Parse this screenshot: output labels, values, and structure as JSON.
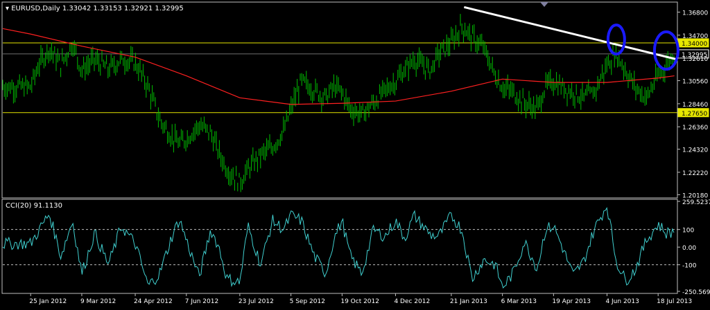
{
  "header": {
    "symbol_label": "EURUSD,Daily",
    "ohlc": "1.33042 1.33153 1.32921 1.32995"
  },
  "indicator": {
    "label": "CCI(20) 91.1130"
  },
  "colors": {
    "background": "#000000",
    "frame": "#c0c0c0",
    "bars": "#00c000",
    "moving_average": "#ff2020",
    "trendline": "#ffffff",
    "horizontal_levels": "#e6e600",
    "circles": "#1a1aff",
    "cci": "#40d0d0",
    "cci_levels": "#c0c0c0",
    "axis_text": "#ffffff",
    "current_price_box": "#ffffff"
  },
  "chart_data": [
    {
      "type": "line",
      "title": "EURUSD,Daily",
      "x_tick_labels": [
        "25 Jan 2012",
        "9 Mar 2012",
        "24 Apr 2012",
        "7 Jun 2012",
        "23 Jul 2012",
        "5 Sep 2012",
        "19 Oct 2012",
        "4 Dec 2012",
        "21 Jan 2013",
        "6 Mar 2013",
        "19 Apr 2013",
        "4 Jun 2013",
        "18 Jul 2013"
      ],
      "y_tick_labels": [
        "1.36800",
        "1.34700",
        "1.32610",
        "1.30560",
        "1.28460",
        "1.26360",
        "1.24320",
        "1.22220",
        "1.20180"
      ],
      "ylim": [
        1.1995,
        1.3765
      ],
      "price_level_labels": [
        "1.34000",
        "1.32995",
        "1.27650"
      ],
      "series": [
        {
          "marks": "daily_bars",
          "x": [
            "2012-01-25",
            "2012-02-01",
            "2012-02-10",
            "2012-02-20",
            "2012-03-01",
            "2012-03-09",
            "2012-03-20",
            "2012-04-01",
            "2012-04-12",
            "2012-04-24",
            "2012-05-05",
            "2012-05-15",
            "2012-05-25",
            "2012-06-01",
            "2012-06-07",
            "2012-06-18",
            "2012-06-28",
            "2012-07-05",
            "2012-07-12",
            "2012-07-23",
            "2012-07-30",
            "2012-08-10",
            "2012-08-20",
            "2012-08-30",
            "2012-09-05",
            "2012-09-14",
            "2012-09-25",
            "2012-10-05",
            "2012-10-12",
            "2012-10-19",
            "2012-10-26",
            "2012-11-05",
            "2012-11-15",
            "2012-11-25",
            "2012-12-04",
            "2012-12-12",
            "2012-12-20",
            "2013-01-03",
            "2013-01-10",
            "2013-01-21",
            "2013-01-30",
            "2013-02-08",
            "2013-02-18",
            "2013-02-28",
            "2013-03-06",
            "2013-03-15",
            "2013-03-25",
            "2013-04-05",
            "2013-04-12",
            "2013-04-19",
            "2013-04-26",
            "2013-05-06",
            "2013-05-15",
            "2013-05-24",
            "2013-06-04",
            "2013-06-12",
            "2013-06-20",
            "2013-06-28",
            "2013-07-08",
            "2013-07-18",
            "2013-07-25",
            "2013-08-01"
          ],
          "values": [
            1.3,
            1.32,
            1.335,
            1.32,
            1.34,
            1.315,
            1.325,
            1.316,
            1.325,
            1.322,
            1.3,
            1.27,
            1.255,
            1.248,
            1.253,
            1.265,
            1.258,
            1.24,
            1.225,
            1.213,
            1.225,
            1.238,
            1.245,
            1.26,
            1.28,
            1.305,
            1.297,
            1.29,
            1.3,
            1.295,
            1.28,
            1.275,
            1.285,
            1.297,
            1.305,
            1.315,
            1.325,
            1.315,
            1.33,
            1.34,
            1.355,
            1.345,
            1.335,
            1.31,
            1.3,
            1.295,
            1.285,
            1.28,
            1.3,
            1.305,
            1.3,
            1.295,
            1.29,
            1.295,
            1.32,
            1.33,
            1.315,
            1.3,
            1.29,
            1.31,
            1.32,
            1.33
          ]
        },
        {
          "marks": "moving_average",
          "x": [
            "2012-01-01",
            "2012-01-25",
            "2012-03-09",
            "2012-04-24",
            "2012-06-07",
            "2012-07-23",
            "2012-09-05",
            "2012-10-19",
            "2012-12-04",
            "2013-01-21",
            "2013-03-06",
            "2013-04-19",
            "2013-06-04",
            "2013-07-18",
            "2013-08-01"
          ],
          "values": [
            1.353,
            1.348,
            1.337,
            1.327,
            1.31,
            1.29,
            1.284,
            1.285,
            1.287,
            1.296,
            1.307,
            1.304,
            1.304,
            1.308,
            1.31
          ]
        },
        {
          "marks": "trendline",
          "x": [
            "2013-02-01",
            "2013-08-03"
          ],
          "values": [
            1.3725,
            1.325
          ]
        }
      ]
    },
    {
      "type": "line",
      "title": "CCI(20) 91.1130",
      "x_tick_labels": [
        "25 Jan 2012",
        "9 Mar 2012",
        "24 Apr 2012",
        "7 Jun 2012",
        "23 Jul 2012",
        "5 Sep 2012",
        "19 Oct 2012",
        "4 Dec 2012",
        "21 Jan 2013",
        "6 Mar 2013",
        "19 Apr 2013",
        "4 Jun 2013",
        "18 Jul 2013"
      ],
      "y_tick_labels": [
        "259.5237",
        "100",
        "0.00",
        "-100",
        "-250.569"
      ],
      "ylim": [
        -250.569,
        259.5237
      ],
      "levels": [
        100,
        -100
      ],
      "series": [
        {
          "name": "CCI(20)",
          "x": [
            "2012-01-25",
            "2012-02-10",
            "2012-02-20",
            "2012-03-01",
            "2012-03-09",
            "2012-03-20",
            "2012-04-01",
            "2012-04-12",
            "2012-04-24",
            "2012-05-05",
            "2012-05-15",
            "2012-05-25",
            "2012-06-01",
            "2012-06-07",
            "2012-06-18",
            "2012-06-28",
            "2012-07-05",
            "2012-07-12",
            "2012-07-23",
            "2012-07-30",
            "2012-08-10",
            "2012-08-20",
            "2012-08-30",
            "2012-09-05",
            "2012-09-14",
            "2012-09-25",
            "2012-10-05",
            "2012-10-12",
            "2012-10-19",
            "2012-10-26",
            "2012-11-05",
            "2012-11-15",
            "2012-11-25",
            "2012-12-04",
            "2012-12-12",
            "2012-12-20",
            "2013-01-03",
            "2013-01-10",
            "2013-01-21",
            "2013-01-30",
            "2013-02-08",
            "2013-02-18",
            "2013-02-28",
            "2013-03-06",
            "2013-03-15",
            "2013-03-25",
            "2013-04-05",
            "2013-04-12",
            "2013-04-19",
            "2013-04-26",
            "2013-05-06",
            "2013-05-15",
            "2013-05-24",
            "2013-06-04",
            "2013-06-12",
            "2013-06-20",
            "2013-06-28",
            "2013-07-08",
            "2013-07-18",
            "2013-07-25",
            "2013-08-01"
          ],
          "values": [
            20,
            190,
            -50,
            150,
            -150,
            80,
            -100,
            120,
            20,
            -220,
            -150,
            50,
            160,
            40,
            -170,
            100,
            0,
            -180,
            -200,
            120,
            -100,
            150,
            100,
            180,
            150,
            -50,
            -150,
            50,
            150,
            -50,
            -150,
            100,
            60,
            150,
            50,
            180,
            70,
            60,
            180,
            100,
            -180,
            -70,
            -100,
            -230,
            -150,
            30,
            -120,
            100,
            120,
            10,
            -160,
            -80,
            100,
            240,
            -80,
            -190,
            -130,
            40,
            130,
            80,
            90
          ]
        }
      ]
    }
  ]
}
